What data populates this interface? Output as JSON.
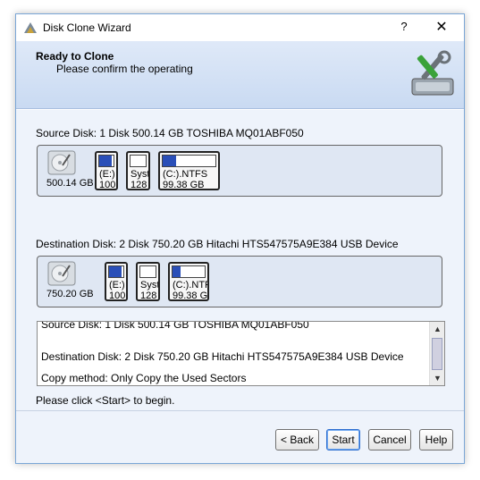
{
  "window": {
    "title": "Disk Clone Wizard",
    "help_label": "?",
    "close_label": "✕"
  },
  "header": {
    "title": "Ready to Clone",
    "subtitle": "Please confirm the operating",
    "icon": "wizard-tools-icon"
  },
  "source": {
    "label": "Source Disk: 1 Disk 500.14 GB TOSHIBA MQ01ABF050",
    "disk_size": "500.14 GB",
    "partitions": [
      {
        "line1": "(E:)",
        "line2": "100",
        "fill": 0.85
      },
      {
        "line1": "Syst",
        "line2": "128",
        "fill": 0.0
      },
      {
        "line1": "(C:).NTFS",
        "line2": "99.38 GB",
        "fill": 0.25
      }
    ]
  },
  "destination": {
    "label": "Destination Disk: 2 Disk 750.20 GB Hitachi HTS547575A9E384 USB Device",
    "disk_size": "750.20 GB",
    "partitions": [
      {
        "line1": "(E:)",
        "line2": "100",
        "fill": 0.85
      },
      {
        "line1": "Syst",
        "line2": "128",
        "fill": 0.0
      },
      {
        "line1": "(C:).NTF",
        "line2": "99.38 G",
        "fill": 0.25
      }
    ]
  },
  "summary": {
    "lines": [
      "Source Disk: 1 Disk 500.14 GB TOSHIBA MQ01ABF050",
      "Destination Disk: 2 Disk 750.20 GB Hitachi HTS547575A9E384 USB Device",
      "Copy method: Only Copy the Used Sectors"
    ]
  },
  "hint": "Please click <Start> to begin.",
  "buttons": {
    "back": "< Back",
    "start": "Start",
    "cancel": "Cancel",
    "help": "Help"
  },
  "colors": {
    "accent": "#2a4fb8",
    "header_bg": "#c9daf2"
  }
}
